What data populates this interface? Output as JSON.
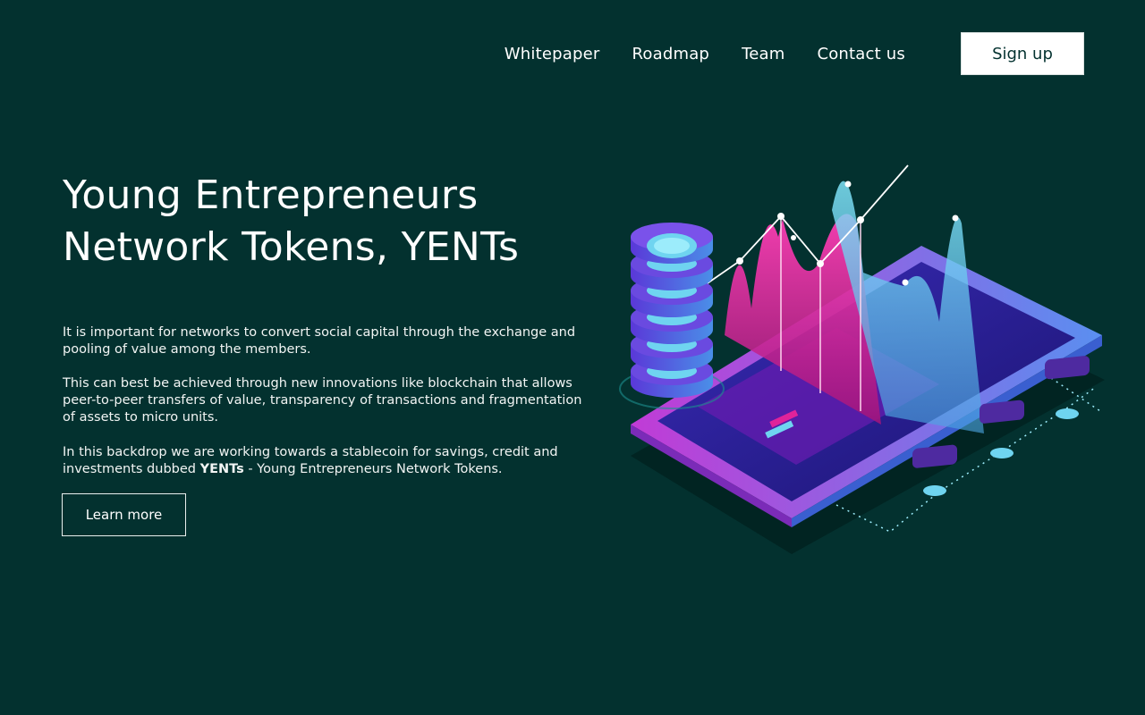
{
  "nav": {
    "items": [
      "Whitepaper",
      "Roadmap",
      "Team",
      "Contact us"
    ],
    "signup_label": "Sign up"
  },
  "hero": {
    "title_line1": "Young Entrepreneurs",
    "title_line2": "Network Tokens, YENTs",
    "paragraph1": "It is important for networks to convert social capital through the exchange and pooling of value among the members.",
    "paragraph2": "This can best be achieved through new innovations like blockchain that allows peer-to-peer transfers of value, transparency of transactions and fragmentation of assets to micro units.",
    "paragraph3_prefix": "In this backdrop we are working towards a stablecoin for savings, credit and investments dubbed ",
    "paragraph3_bold": "YENTs",
    "paragraph3_suffix": " - Young Entrepreneurs Network Tokens.",
    "learn_more_label": "Learn more"
  },
  "colors": {
    "background": "#03312f",
    "accent_magenta": "#e0239a",
    "accent_cyan": "#6fd4f0",
    "accent_purple": "#6a2bd9"
  },
  "illustration": {
    "icon": "blockchain-tablet-chart-illustration"
  }
}
